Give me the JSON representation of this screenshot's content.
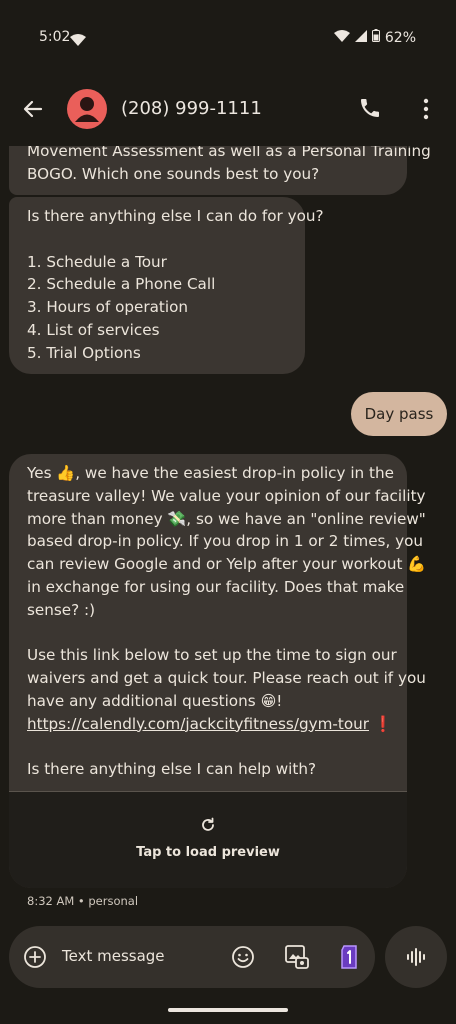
{
  "status": {
    "time": "5:02",
    "battery": "62%"
  },
  "header": {
    "contact": "(208) 999-1111"
  },
  "messages": {
    "m1_lines": [
      "Movement Assessment as well as a Personal Training",
      "BOGO. Which one sounds best to you?"
    ],
    "m2_lines": [
      "Is there anything else I can do for you?",
      "",
      "1. Schedule a Tour",
      "2. Schedule a Phone Call",
      "3. Hours of operation",
      "4. List of services",
      "5. Trial Options"
    ],
    "out_text": "Day pass",
    "m3_lines": [
      "Yes 👍, we have the easiest drop-in policy in the",
      "treasure valley! We value your opinion of our facility",
      "more than money 💸, so we have an \"online review\"",
      "based drop-in policy. If you drop in 1 or 2 times, you",
      "can review Google and or Yelp after your workout 💪",
      "in exchange for using our facility. Does that make",
      "sense? :)",
      "",
      "Use this link below to set up the time to sign our",
      "waivers and get a quick tour. Please reach out if you",
      "have any additional questions 😁!"
    ],
    "m3_link": "https://calendly.com/jackcityfitness/gym-tour",
    "m3_link_suffix": " ❗",
    "m3_last": "Is there anything else I can help with?",
    "preview_label": "Tap to load preview",
    "meta": "8:32 AM • personal"
  },
  "composer": {
    "placeholder": "Text message"
  },
  "icons": {
    "back": "back-arrow-icon",
    "call": "phone-icon",
    "more": "more-vert-icon",
    "add": "add-circle-icon",
    "emoji": "emoji-icon",
    "gallery": "gallery-icon",
    "sim": "sim-1-icon",
    "voice": "voice-waveform-icon",
    "reload": "reload-icon"
  }
}
